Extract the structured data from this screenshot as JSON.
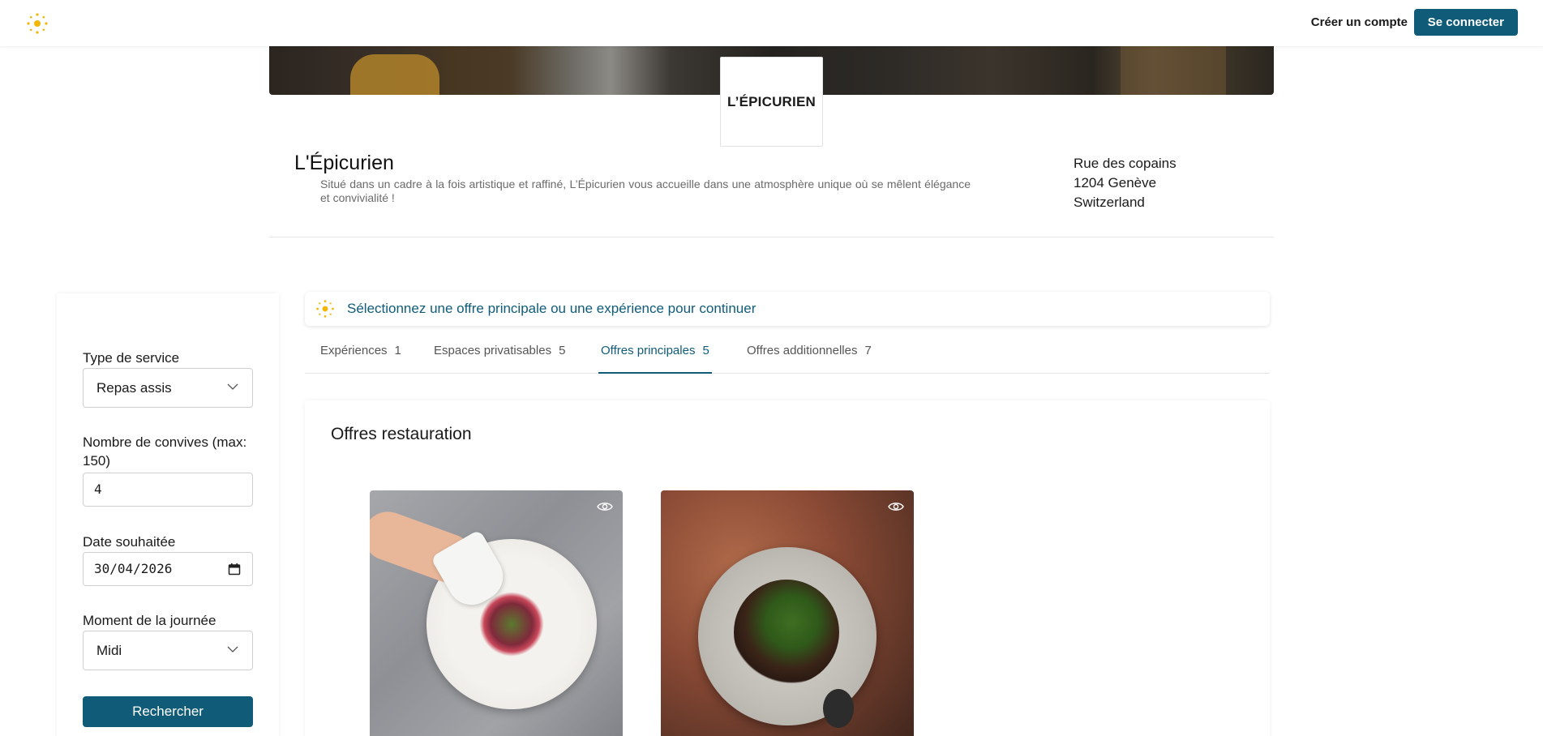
{
  "nav": {
    "create_account": "Créer un compte",
    "login": "Se connecter"
  },
  "venue": {
    "logo_text": "L’ÉPICURIEN",
    "name": "L'Épicurien",
    "description": "Situé dans un cadre à la fois artistique et raffiné, L’Épicurien vous accueille dans une atmosphère unique où se mêlent élégance et convivialité !",
    "address": {
      "street": "Rue des copains",
      "city": "1204 Genève",
      "country": "Switzerland"
    }
  },
  "filters": {
    "service_type": {
      "label": "Type de service",
      "value": "Repas assis"
    },
    "guests": {
      "label": "Nombre de convives (max: 150)",
      "value": "4"
    },
    "date": {
      "label": "Date souhaitée",
      "value": "30/04/2026"
    },
    "moment": {
      "label": "Moment de la journée",
      "value": "Midi"
    },
    "search_button": "Rechercher"
  },
  "notice": {
    "text": "Sélectionnez une offre principale ou une expérience pour continuer"
  },
  "tabs": [
    {
      "label": "Expériences",
      "count": "1"
    },
    {
      "label": "Espaces privatisables",
      "count": "5"
    },
    {
      "label": "Offres principales",
      "count": "5"
    },
    {
      "label": "Offres additionnelles",
      "count": "7"
    }
  ],
  "offers": {
    "title": "Offres restauration"
  },
  "colors": {
    "brand": "#0f5b78",
    "sun": "#f2b705"
  },
  "icons": {
    "logo": "sun-icon",
    "chevron": "chevron-down-icon",
    "calendar": "calendar-icon",
    "preview": "eye-icon"
  }
}
